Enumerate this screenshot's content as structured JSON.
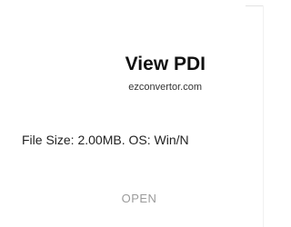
{
  "ad": {
    "title": "View PDI",
    "domain": "ezconvertor.com",
    "file_info": "File Size: 2.00MB. OS: Win/N",
    "cta_label": "OPEN"
  }
}
